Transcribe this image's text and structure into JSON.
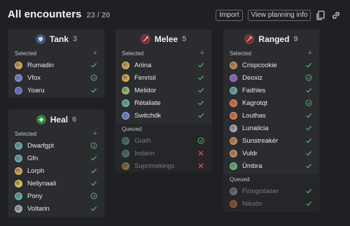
{
  "header": {
    "title": "All encounters",
    "count": "23 / 20",
    "import_label": "Import",
    "planning_label": "View planning info"
  },
  "roles": {
    "tank": {
      "name": "Tank",
      "count": "3",
      "selected_label": "Selected",
      "selected": [
        {
          "name": "Rumadin",
          "status": "check",
          "color": "#d9a23a"
        },
        {
          "name": "Vfox",
          "status": "circle",
          "color": "#6b7fd6"
        },
        {
          "name": "Yoaru",
          "status": "check",
          "color": "#5b6bd0"
        }
      ]
    },
    "heal": {
      "name": "Heal",
      "count": "6",
      "selected_label": "Selected",
      "selected": [
        {
          "name": "Dwarfgpt",
          "status": "circle",
          "color": "#4fa7a3"
        },
        {
          "name": "Gfn",
          "status": "check",
          "color": "#4fa7a3"
        },
        {
          "name": "Lorph",
          "status": "check",
          "color": "#d9a23a"
        },
        {
          "name": "Nellynaali",
          "status": "check",
          "color": "#d9c23a"
        },
        {
          "name": "Pony",
          "status": "circle",
          "color": "#4fa7a3"
        },
        {
          "name": "Voltarin",
          "status": "check",
          "color": "#9ea2b0"
        }
      ]
    },
    "melee": {
      "name": "Melee",
      "count": "5",
      "selected_label": "Selected",
      "queued_label": "Queued",
      "selected": [
        {
          "name": "Ariina",
          "status": "check",
          "color": "#d9a23a"
        },
        {
          "name": "Fenrisil",
          "status": "check",
          "color": "#d9a23a"
        },
        {
          "name": "Melidor",
          "status": "check",
          "color": "#8fbf4a"
        },
        {
          "name": "Rétaliate",
          "status": "check",
          "color": "#4fa7a3"
        },
        {
          "name": "Switchdk",
          "status": "check",
          "color": "#6b7fd6"
        }
      ],
      "queued": [
        {
          "name": "Grath",
          "status": "circle",
          "color": "#4fae6a"
        },
        {
          "name": "Indann",
          "status": "cross",
          "color": "#4fa7a3"
        },
        {
          "name": "Suprimekings",
          "status": "cross",
          "color": "#d9a23a"
        }
      ]
    },
    "ranged": {
      "name": "Ranged",
      "count": "9",
      "selected_label": "Selected",
      "queued_label": "Queued",
      "selected": [
        {
          "name": "Crispcookie",
          "status": "check",
          "color": "#c87a3a"
        },
        {
          "name": "Deoxiz",
          "status": "circle",
          "color": "#8a5bc8"
        },
        {
          "name": "Faithles",
          "status": "check",
          "color": "#4fa7a3"
        },
        {
          "name": "Kagrotqt",
          "status": "circle",
          "color": "#e0692a"
        },
        {
          "name": "Louthas",
          "status": "check",
          "color": "#e0692a"
        },
        {
          "name": "Lunalicia",
          "status": "check",
          "color": "#9ea2b0"
        },
        {
          "name": "Sunstreakér",
          "status": "check",
          "color": "#c87a3a"
        },
        {
          "name": "Vuldr",
          "status": "check",
          "color": "#c87a3a"
        },
        {
          "name": "Úmbra",
          "status": "check",
          "color": "#4fae6a"
        }
      ],
      "queued": [
        {
          "name": "Firingmlaser",
          "status": "check",
          "color": "#9ea2b0"
        },
        {
          "name": "Niksön",
          "status": "check",
          "color": "#e0692a"
        }
      ]
    }
  },
  "colors": {
    "check": "#4fae6a",
    "circle": "#4fae6a",
    "cross": "#d14a4a",
    "tank_icon": "#3a5a8c",
    "heal_icon": "#2f8f3a",
    "melee_icon": "#8c2a2a",
    "ranged_icon": "#8c2a2a"
  }
}
